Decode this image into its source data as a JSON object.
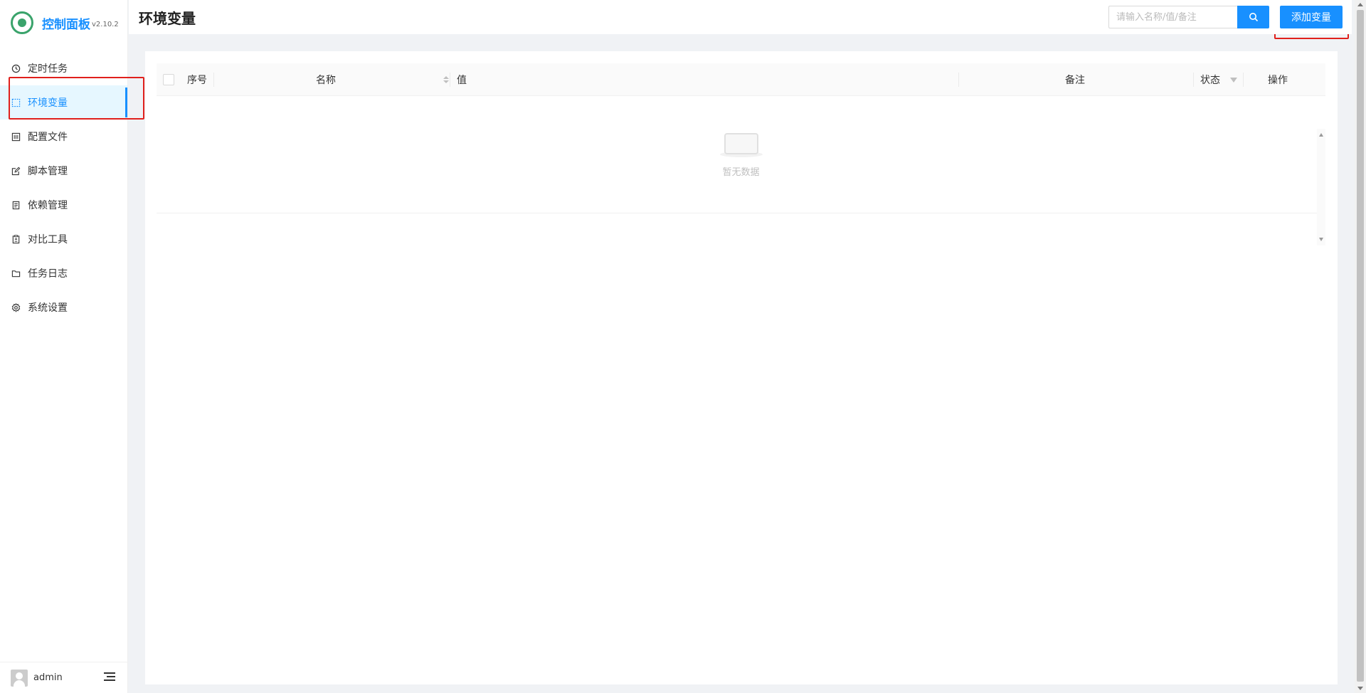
{
  "brand": {
    "title": "控制面板",
    "version": "v2.10.2"
  },
  "sidebar": {
    "items": [
      {
        "label": "定时任务",
        "icon": "clock-icon"
      },
      {
        "label": "环境变量",
        "icon": "variable-icon",
        "active": true
      },
      {
        "label": "配置文件",
        "icon": "config-icon"
      },
      {
        "label": "脚本管理",
        "icon": "edit-icon"
      },
      {
        "label": "依赖管理",
        "icon": "package-icon"
      },
      {
        "label": "对比工具",
        "icon": "diff-icon"
      },
      {
        "label": "任务日志",
        "icon": "folder-icon"
      },
      {
        "label": "系统设置",
        "icon": "gear-icon"
      }
    ]
  },
  "user": {
    "name": "admin"
  },
  "header": {
    "title": "环境变量",
    "search_placeholder": "请输入名称/值/备注",
    "add_label": "添加变量"
  },
  "table": {
    "columns": [
      "序号",
      "名称",
      "值",
      "备注",
      "状态",
      "操作"
    ],
    "empty_text": "暂无数据"
  },
  "colors": {
    "accent": "#1890ff",
    "highlight": "#e0201c"
  }
}
